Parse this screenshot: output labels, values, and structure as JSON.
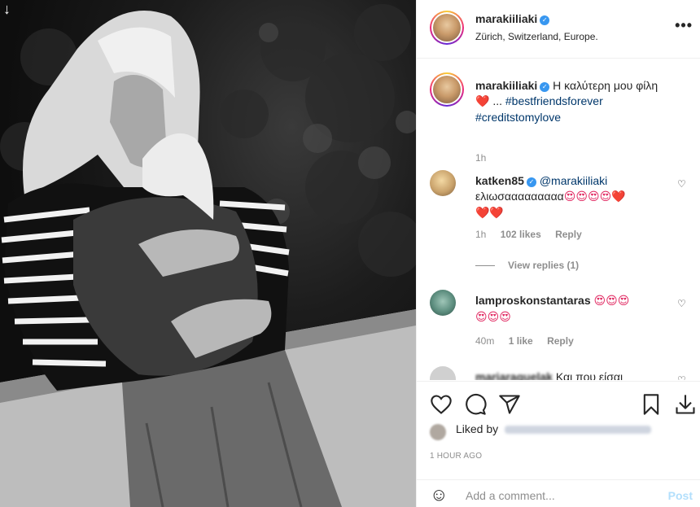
{
  "header": {
    "username": "marakiiliaki",
    "location": "Zürich, Switzerland, Europe.",
    "more_glyph": "•••"
  },
  "caption": {
    "username": "marakiiliaki",
    "text": "Η καλύτερη μου φίλη",
    "emoji": "❤️",
    "ellipsis": "...",
    "tag1": "#bestfriendsforever",
    "tag2": "#creditstomylove",
    "time": "1h"
  },
  "comments": [
    {
      "username": "katken85",
      "mention": "@marakiiliaki",
      "text": "ελιωσααααααααα",
      "emojis_line1": "😍😍😍😍❤️",
      "emojis_line2": "❤️❤️",
      "time": "1h",
      "likes": "102 likes",
      "reply": "Reply",
      "view_replies": "View replies (1)"
    },
    {
      "username": "lamproskonstantaras",
      "emojis_line1": "😍😍😍",
      "emojis_line2": "😍😍😍",
      "time": "40m",
      "likes": "1 like",
      "reply": "Reply"
    },
    {
      "username": "mariaraquelak",
      "text": "Και που είσαι"
    }
  ],
  "actions": {
    "liked_by_label": "Liked by",
    "time_ago": "1 HOUR AGO",
    "add_comment_placeholder": "Add a comment...",
    "post_label": "Post"
  },
  "icons": [
    "download-arrow-icon",
    "verified-badge-icon",
    "more-options-icon",
    "heart-icon",
    "comment-icon",
    "share-icon",
    "bookmark-icon",
    "download-icon",
    "emoji-icon"
  ],
  "colors": {
    "verified": "#3897f0",
    "link": "#00376b",
    "muted": "#8e8e8e",
    "post_disabled": "#b2dffc"
  }
}
